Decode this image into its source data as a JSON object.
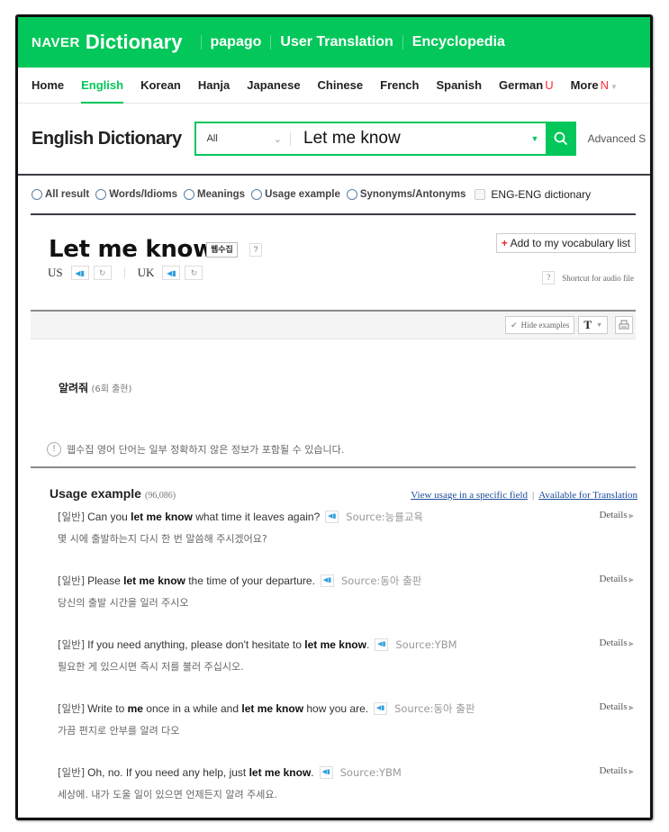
{
  "topbar": {
    "brand_naver": "NAVER",
    "brand_dict": "Dictionary",
    "links": [
      "papago",
      "User Translation",
      "Encyclopedia"
    ]
  },
  "nav": {
    "items": [
      {
        "label": "Home",
        "active": false,
        "badge": ""
      },
      {
        "label": "English",
        "active": true,
        "badge": ""
      },
      {
        "label": "Korean",
        "active": false,
        "badge": ""
      },
      {
        "label": "Hanja",
        "active": false,
        "badge": ""
      },
      {
        "label": "Japanese",
        "active": false,
        "badge": ""
      },
      {
        "label": "Chinese",
        "active": false,
        "badge": ""
      },
      {
        "label": "French",
        "active": false,
        "badge": ""
      },
      {
        "label": "Spanish",
        "active": false,
        "badge": ""
      },
      {
        "label": "German",
        "active": false,
        "badge": "U"
      },
      {
        "label": "More",
        "active": false,
        "badge": "N"
      }
    ]
  },
  "header": {
    "title": "English Dictionary",
    "scope": "All",
    "query": "Let me know",
    "advanced": "Advanced S"
  },
  "filters": {
    "radios": [
      "All result",
      "Words/Idioms",
      "Meanings",
      "Usage example",
      "Synonyms/Antonyms"
    ],
    "checkbox": "ENG-ENG dictionary"
  },
  "entry": {
    "word": "Let me know",
    "badge": "웹수집",
    "help": "?",
    "pron_us": "US",
    "pron_uk": "UK",
    "vocab_plus": "+",
    "vocab_label": "Add to my vocabulary list",
    "shortcut_label": "Shortcut for audio file"
  },
  "toolbar": {
    "hide_examples": "Hide examples",
    "font": "T"
  },
  "meaning": {
    "word": "알려줘",
    "count": "(6회 출현)",
    "notice": "웹수집 영어 단어는 일부 정확하지 않은 정보가 포함될 수 있습니다."
  },
  "usage": {
    "title": "Usage example",
    "count": "(96,086)",
    "link_field": "View usage in a specific field",
    "link_translation": "Available for Translation",
    "details_label": "Details",
    "examples": [
      {
        "cat": "[일반]",
        "pre": "Can you ",
        "bold": "let me know",
        "post": " what time it leaves again?",
        "source": "Source:능률교육",
        "ko": "몇 시에 출발하는지 다시 한 번 말씀해 주시겠어요?"
      },
      {
        "cat": "[일반]",
        "pre": "Please ",
        "bold": "let me know",
        "post": " the time of your departure.",
        "source": "Source:동아 출판",
        "ko": "당신의 출발 시간을 일러 주시오"
      },
      {
        "cat": "[일반]",
        "pre": "If you need anything, please don't hesitate to ",
        "bold": "let me know",
        "post": ".",
        "source": "Source:YBM",
        "ko": "필요한 게 있으시면 즉시 저를 불러 주십시오."
      },
      {
        "cat": "[일반]",
        "pre": "Write to ",
        "bold": "me",
        "mid": " once in a while and ",
        "bold2": "let me know",
        "post": " how you are.",
        "source": "Source:동아 출판",
        "ko": "가끔 편지로 안부를 알려 다오"
      },
      {
        "cat": "[일반]",
        "pre": "Oh, no. If you need any help, just ",
        "bold": "let me know",
        "post": ".",
        "source": "Source:YBM",
        "ko": "세상에. 내가 도울 일이 있으면 언제든지 알려 주세요."
      }
    ]
  },
  "colors": {
    "brand_green": "#03c75a",
    "link_blue": "#1d4c9b",
    "badge_red": "#ff2b3a"
  }
}
